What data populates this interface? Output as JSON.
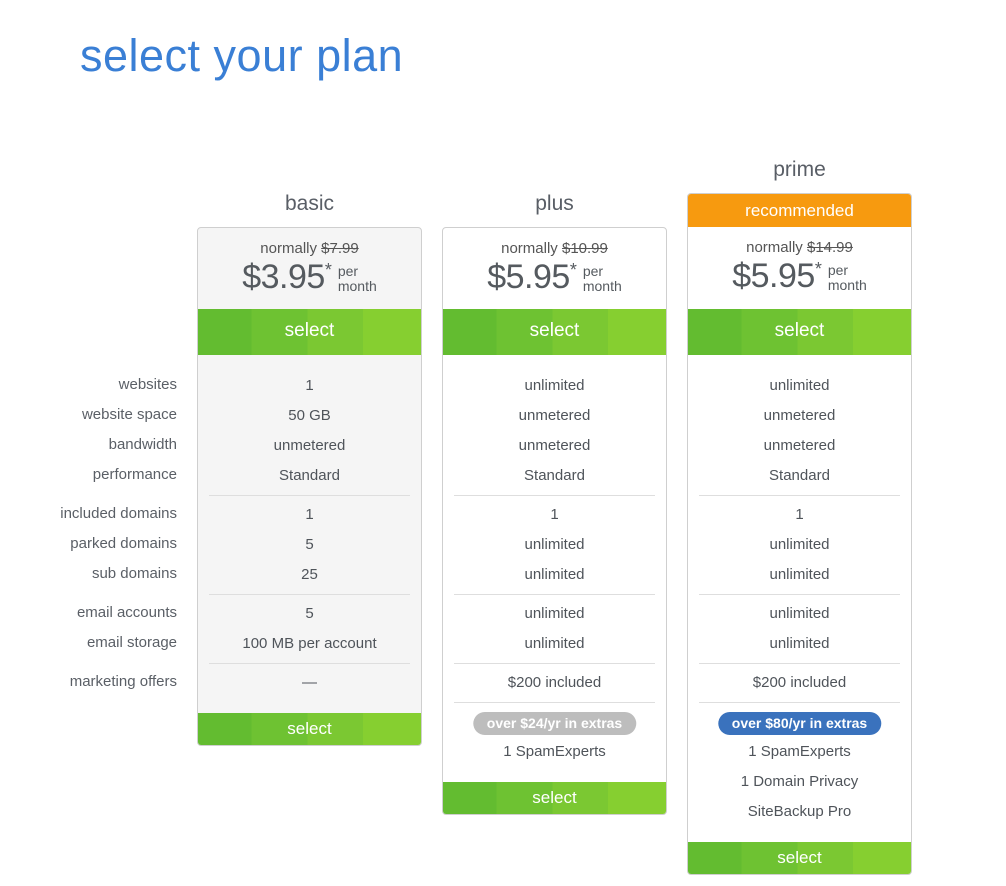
{
  "page": {
    "title": "select your plan"
  },
  "feature_labels": [
    "websites",
    "website space",
    "bandwidth",
    "performance",
    "included domains",
    "parked domains",
    "sub domains",
    "email accounts",
    "email storage",
    "marketing offers"
  ],
  "colors": {
    "title": "#3a7fd5",
    "recommended": "#f79a0f",
    "select_green": "#6ec232",
    "extras_gray": "#bdbdbd",
    "extras_blue": "#3a72bd"
  },
  "plans": [
    {
      "name": "basic",
      "normally_label": "normally",
      "normal_price": "$7.99",
      "price": "$3.95",
      "asterisk": "*",
      "per": "per",
      "month": "month",
      "select_label": "select",
      "features": [
        "1",
        "50 GB",
        "unmetered",
        "Standard",
        "1",
        "5",
        "25",
        "5",
        "100 MB per account",
        "—"
      ]
    },
    {
      "name": "plus",
      "normally_label": "normally",
      "normal_price": "$10.99",
      "price": "$5.95",
      "asterisk": "*",
      "per": "per",
      "month": "month",
      "select_label": "select",
      "features": [
        "unlimited",
        "unmetered",
        "unmetered",
        "Standard",
        "1",
        "unlimited",
        "unlimited",
        "unlimited",
        "unlimited",
        "$200 included"
      ],
      "extras_badge": "over $24/yr in extras",
      "extras": [
        "1 SpamExperts"
      ]
    },
    {
      "name": "prime",
      "badge": "recommended",
      "normally_label": "normally",
      "normal_price": "$14.99",
      "price": "$5.95",
      "asterisk": "*",
      "per": "per",
      "month": "month",
      "select_label": "select",
      "features": [
        "unlimited",
        "unmetered",
        "unmetered",
        "Standard",
        "1",
        "unlimited",
        "unlimited",
        "unlimited",
        "unlimited",
        "$200 included"
      ],
      "extras_badge": "over $80/yr in extras",
      "extras": [
        "1 SpamExperts",
        "1 Domain Privacy",
        "SiteBackup Pro"
      ]
    }
  ]
}
